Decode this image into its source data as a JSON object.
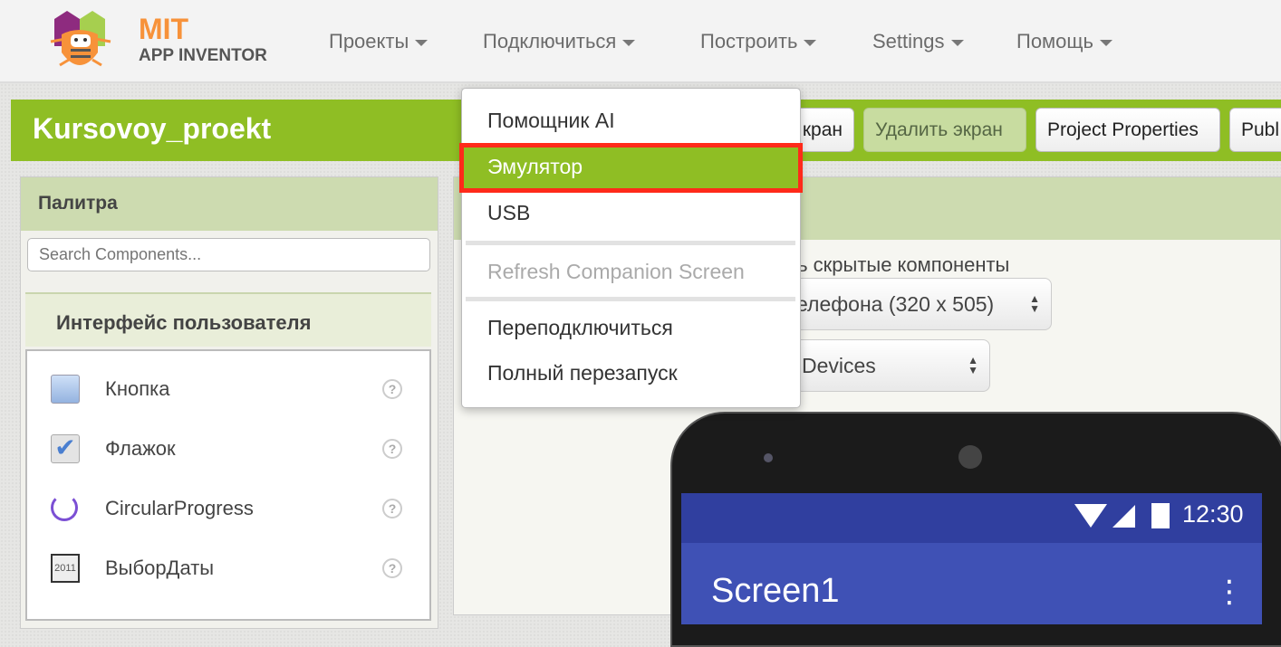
{
  "header": {
    "logo_top": "MIT",
    "logo_bottom": "APP INVENTOR",
    "menus": [
      "Проекты",
      "Подключиться",
      "Построить",
      "Settings",
      "Помощь"
    ]
  },
  "project": {
    "title": "Kursovoy_proekt",
    "buttons": {
      "add_screen_partial": "кран",
      "delete_screen": "Удалить экран",
      "properties": "Project Properties",
      "publish_partial": "Publ"
    }
  },
  "palette": {
    "title": "Палитра",
    "search_placeholder": "Search Components...",
    "category": "Интерфейс пользователя",
    "items": [
      {
        "label": "Кнопка",
        "icon": "button-icon"
      },
      {
        "label": "Флажок",
        "icon": "checkbox-icon"
      },
      {
        "label": "CircularProgress",
        "icon": "circular-progress-icon"
      },
      {
        "label": "ВыборДаты",
        "icon": "date-picker-icon"
      }
    ],
    "help": "?"
  },
  "viewer": {
    "hidden_components_partial": "ть скрытые компоненты",
    "size_select_partial": "елефона (320 x 505)",
    "devices_select_partial": "Devices"
  },
  "phone": {
    "time": "12:30",
    "screen_title": "Screen1",
    "menu": "⋮"
  },
  "connect_menu": {
    "items": [
      "Помощник AI",
      "Эмулятор",
      "USB",
      "Refresh Companion Screen",
      "Переподключиться",
      "Полный перезапуск"
    ],
    "selected": "Эмулятор"
  },
  "colors": {
    "accent": "#8fbe24",
    "highlight_border": "#ff2a1a",
    "status_bar": "#303f9f",
    "app_bar": "#3f51b5"
  }
}
